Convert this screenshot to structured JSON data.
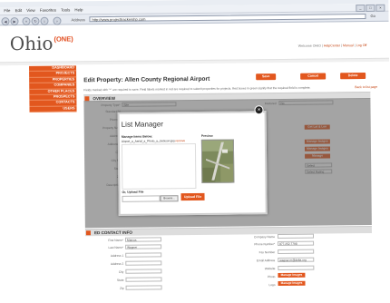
{
  "browser": {
    "menu": [
      "File",
      "Edit",
      "View",
      "Favorites",
      "Tools",
      "Help"
    ],
    "address_label": "Address",
    "address_url": "http://www.projecttrackershp.com",
    "go_label": "Go",
    "window_controls": [
      "_",
      "□",
      "×"
    ]
  },
  "header": {
    "logo_text": "Ohio",
    "logo_badge": "(ONE)",
    "top_links_prefix": "Welcome OHIO",
    "top_links": [
      "HelpCenter",
      "Manual",
      "Log Off"
    ],
    "separator": "|"
  },
  "sidebar": {
    "items": [
      "DASHBOARD",
      "PROJECTS",
      "PROPERTIES",
      "COMPANIES",
      "OTHER PLACES",
      "PROSPECTS",
      "CONTACTS",
      "USERS"
    ]
  },
  "main": {
    "title": "Edit Property: Allen County Regional Airport",
    "buttons": {
      "save": "Save",
      "cancel": "Cancel",
      "delete": "Delete"
    },
    "required_note": "Fields marked with \"*\" are required to save. Field labels marked in red are required to submit properties for projects. Red boxes in green signify that the required field is complete.",
    "back_link": "Back to list page",
    "overview_title": "OVERVIEW",
    "property_type_label": "Property Type*",
    "property_type_value": "Site",
    "featured_label": "Featured",
    "featured_value": "No",
    "side_labels": [
      "Standard N",
      "Phone #",
      "Property Nam",
      "Address",
      "Address 2",
      "City",
      "City No",
      "State",
      "Zip",
      "Description"
    ],
    "right_buttons": [
      "Get Lat & Lon",
      "Manage Images",
      "Manage Images",
      "Manage Documents"
    ],
    "right_select_values": [
      "Select Improvement",
      "Select Rating"
    ],
    "ed_contact_title": "ED CONTACT INFO",
    "contact_left": [
      {
        "label": "First Name*",
        "value": "Marcus"
      },
      {
        "label": "Last Name*",
        "value": "Wagner"
      },
      {
        "label": "Address 1",
        "value": ""
      },
      {
        "label": "Address 2",
        "value": ""
      },
      {
        "label": "City",
        "value": ""
      },
      {
        "label": "State",
        "value": ""
      },
      {
        "label": "Zip",
        "value": ""
      }
    ],
    "contact_right": [
      {
        "label": "Company Name",
        "value": ""
      },
      {
        "label": "Phone Number*",
        "value": "877.252.7798"
      },
      {
        "label": "Fax Number",
        "value": ""
      },
      {
        "label": "Email Address",
        "value": "wagner.m@delta.org"
      },
      {
        "label": "Website",
        "value": ""
      },
      {
        "label": "Photo",
        "value": "Manage Images"
      },
      {
        "label": "Logo",
        "value": "Manage Images"
      }
    ]
  },
  "modal": {
    "title": "List Manager",
    "items_label": "Manage Items Below:",
    "file_name": "Airport_a_Aerial_a_Photo_a_Jackson.jpg",
    "remove_label": "remove",
    "preview_label": "Preview",
    "upload_label": "Or, Upload File",
    "browse_label": "Browse...",
    "upload_button": "Upload File",
    "close_glyph": "×"
  },
  "colors": {
    "accent": "#e2571e",
    "overlay": "#5a5a5a",
    "sidebar_text": "#ffffff"
  }
}
